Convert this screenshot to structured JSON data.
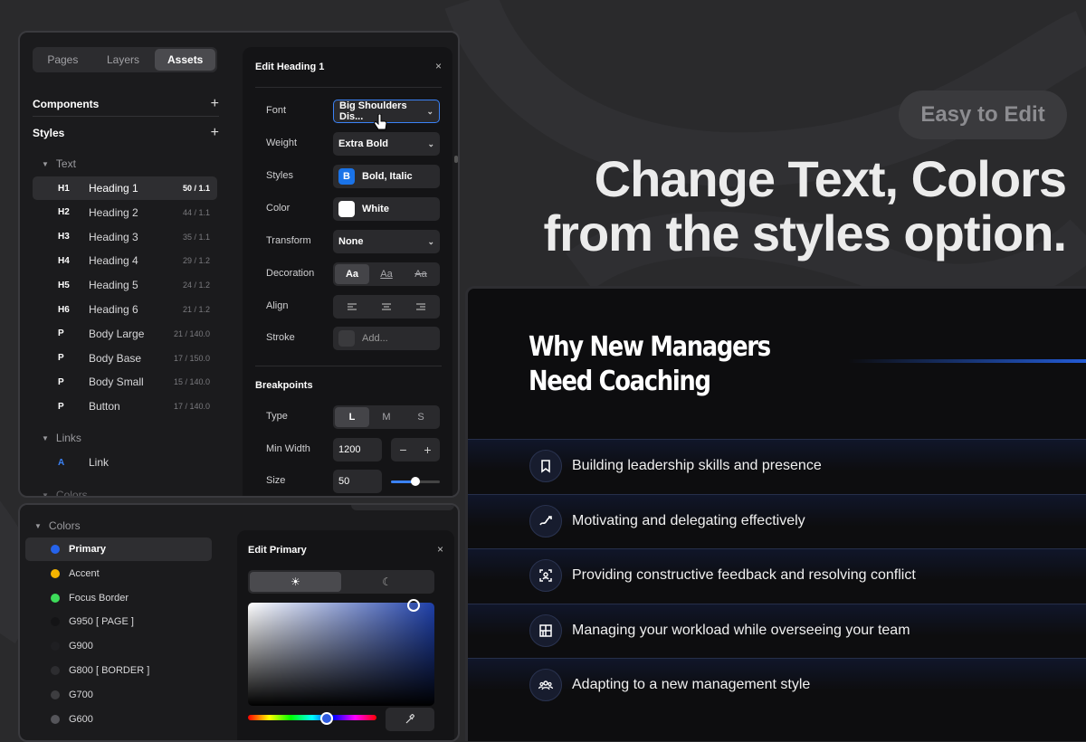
{
  "sidebar": {
    "tabs": [
      "Pages",
      "Layers",
      "Assets"
    ],
    "active_tab": "Assets",
    "components_label": "Components",
    "styles_label": "Styles",
    "text_group": "Text",
    "text_styles": [
      {
        "tag": "H1",
        "name": "Heading 1",
        "value": "50 / 1.1"
      },
      {
        "tag": "H2",
        "name": "Heading 2",
        "value": "44 / 1.1"
      },
      {
        "tag": "H3",
        "name": "Heading 3",
        "value": "35 / 1.1"
      },
      {
        "tag": "H4",
        "name": "Heading 4",
        "value": "29 / 1.2"
      },
      {
        "tag": "H5",
        "name": "Heading 5",
        "value": "24 / 1.2"
      },
      {
        "tag": "H6",
        "name": "Heading 6",
        "value": "21 / 1.2"
      },
      {
        "tag": "P",
        "name": "Body Large",
        "value": "21 / 140.0"
      },
      {
        "tag": "P",
        "name": "Body Base",
        "value": "17 / 150.0"
      },
      {
        "tag": "P",
        "name": "Body Small",
        "value": "15 / 140.0"
      },
      {
        "tag": "P",
        "name": "Button",
        "value": "17 / 140.0"
      }
    ],
    "links_group": "Links",
    "link_item": {
      "tag": "A",
      "name": "Link"
    },
    "colors_group_partial": "Colors"
  },
  "edit_heading": {
    "title": "Edit Heading 1",
    "close": "×",
    "font_label": "Font",
    "font_value": "Big Shoulders Dis...",
    "weight_label": "Weight",
    "weight_value": "Extra Bold",
    "styles_label": "Styles",
    "styles_icon": "B",
    "styles_value": "Bold, Italic",
    "color_label": "Color",
    "color_value": "White",
    "transform_label": "Transform",
    "transform_value": "None",
    "decoration_label": "Decoration",
    "decoration_options": [
      "Aa",
      "Aa",
      "Aa"
    ],
    "align_label": "Align",
    "stroke_label": "Stroke",
    "stroke_value": "Add...",
    "breakpoints_title": "Breakpoints",
    "type_label": "Type",
    "type_options": [
      "L",
      "M",
      "S"
    ],
    "type_selected": "L",
    "minwidth_label": "Min Width",
    "minwidth_value": "1200",
    "size_label": "Size",
    "size_value": "50",
    "size_slider_fraction": 0.5
  },
  "colors_panel": {
    "group": "Colors",
    "items": [
      {
        "name": "Primary",
        "color": "#2563eb"
      },
      {
        "name": "Accent",
        "color": "#f5b400"
      },
      {
        "name": "Focus Border",
        "color": "#3ddc5a"
      },
      {
        "name": "G950 [ PAGE ]",
        "color": "#141416"
      },
      {
        "name": "G900",
        "color": "#1f1f22"
      },
      {
        "name": "G800 [ BORDER ]",
        "color": "#2d2d30"
      },
      {
        "name": "G700",
        "color": "#3d3d40"
      },
      {
        "name": "G600",
        "color": "#55555a"
      }
    ],
    "edit_title": "Edit Primary",
    "close": "×"
  },
  "promo": {
    "badge": "Easy to Edit",
    "headline_line1": "Change Text, Colors",
    "headline_line2": "from the styles option."
  },
  "card": {
    "title": "Why New Managers Need Coaching",
    "items": [
      {
        "icon": "bookmark-icon",
        "text": "Building leadership skills and presence"
      },
      {
        "icon": "trend-arrow-icon",
        "text": "Motivating and delegating effectively"
      },
      {
        "icon": "scan-user-icon",
        "text": "Providing constructive feedback and resolving conflict"
      },
      {
        "icon": "layout-grid-icon",
        "text": "Managing your workload while overseeing your team"
      },
      {
        "icon": "users-icon",
        "text": "Adapting to a new management style"
      }
    ]
  },
  "colors": {
    "accent": "#2563eb",
    "bg": "#2a2a2c",
    "panel": "#1b1b1d"
  }
}
